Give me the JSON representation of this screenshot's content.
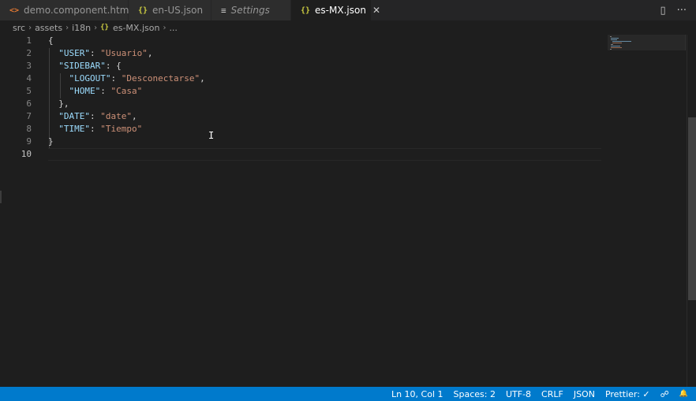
{
  "tabs": [
    {
      "icon": "<>",
      "label": "demo.component.html",
      "active": false
    },
    {
      "icon": "{}",
      "label": "en-US.json",
      "active": false
    },
    {
      "icon": "≡",
      "label": "Settings",
      "active": false
    },
    {
      "icon": "{}",
      "label": "es-MX.json",
      "active": true,
      "close": "✕"
    }
  ],
  "tab_actions": {
    "split": "▯",
    "more": "···"
  },
  "breadcrumb": {
    "parts": [
      "src",
      "assets",
      "i18n"
    ],
    "file_icon": "{}",
    "file": "es-MX.json",
    "ellipsis": "..."
  },
  "editor": {
    "line_numbers": [
      "1",
      "2",
      "3",
      "4",
      "5",
      "6",
      "7",
      "8",
      "9",
      "10"
    ],
    "current_line": 10,
    "lines": [
      [
        {
          "t": "p",
          "v": "{"
        }
      ],
      [
        {
          "t": "p",
          "v": "  "
        },
        {
          "t": "k",
          "v": "\"USER\""
        },
        {
          "t": "p",
          "v": ": "
        },
        {
          "t": "s",
          "v": "\"Usuario\""
        },
        {
          "t": "p",
          "v": ","
        }
      ],
      [
        {
          "t": "p",
          "v": "  "
        },
        {
          "t": "k",
          "v": "\"SIDEBAR\""
        },
        {
          "t": "p",
          "v": ": {"
        }
      ],
      [
        {
          "t": "p",
          "v": "    "
        },
        {
          "t": "k",
          "v": "\"LOGOUT\""
        },
        {
          "t": "p",
          "v": ": "
        },
        {
          "t": "s",
          "v": "\"Desconectarse\""
        },
        {
          "t": "p",
          "v": ","
        }
      ],
      [
        {
          "t": "p",
          "v": "    "
        },
        {
          "t": "k",
          "v": "\"HOME\""
        },
        {
          "t": "p",
          "v": ": "
        },
        {
          "t": "s",
          "v": "\"Casa\""
        }
      ],
      [
        {
          "t": "p",
          "v": "  },"
        }
      ],
      [
        {
          "t": "p",
          "v": "  "
        },
        {
          "t": "k",
          "v": "\"DATE\""
        },
        {
          "t": "p",
          "v": ": "
        },
        {
          "t": "s",
          "v": "\"date\""
        },
        {
          "t": "p",
          "v": ","
        }
      ],
      [
        {
          "t": "p",
          "v": "  "
        },
        {
          "t": "k",
          "v": "\"TIME\""
        },
        {
          "t": "p",
          "v": ": "
        },
        {
          "t": "s",
          "v": "\"Tiempo\""
        }
      ],
      [
        {
          "t": "p",
          "v": "}"
        }
      ],
      []
    ],
    "text_cursor": "I"
  },
  "statusbar": {
    "position": "Ln 10, Col 1",
    "spaces": "Spaces: 2",
    "encoding": "UTF-8",
    "eol": "CRLF",
    "language": "JSON",
    "prettier": "Prettier: ✓",
    "feedback_icon": "☍",
    "bell_icon": "🔔"
  },
  "colors": {
    "accent": "#007acc",
    "key": "#9cdcfe",
    "string": "#ce9178",
    "html_icon": "#e37933",
    "json_icon": "#cbcb41"
  }
}
